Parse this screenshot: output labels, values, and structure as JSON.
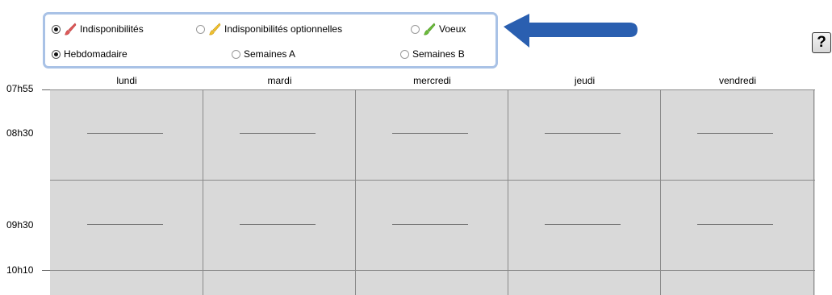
{
  "options": {
    "type_choices": [
      {
        "label": "Indisponibilités",
        "selected": true,
        "brush_color": "#e05a5a"
      },
      {
        "label": "Indisponibilités optionnelles",
        "selected": false,
        "brush_color": "#f2c230"
      },
      {
        "label": "Voeux",
        "selected": false,
        "brush_color": "#6bbf3a"
      }
    ],
    "week_choices": [
      {
        "label": "Hebdomadaire",
        "selected": true
      },
      {
        "label": "Semaines A",
        "selected": false
      },
      {
        "label": "Semaines B",
        "selected": false
      }
    ]
  },
  "help_button": {
    "label": "?"
  },
  "arrow_color": "#2a5fb0",
  "schedule": {
    "days": [
      "lundi",
      "mardi",
      "mercredi",
      "jeudi",
      "vendredi"
    ],
    "times": [
      "07h55",
      "08h30",
      "09h30",
      "10h10"
    ],
    "grid_color": "#d9d9d9"
  }
}
